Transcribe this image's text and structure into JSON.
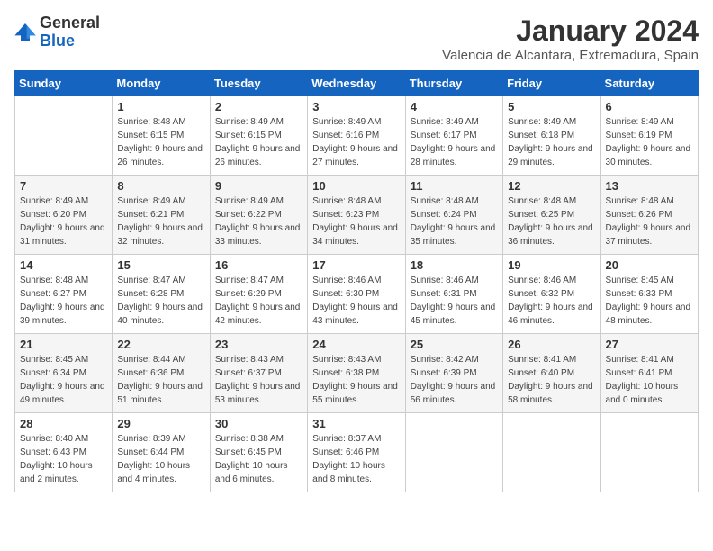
{
  "header": {
    "logo_general": "General",
    "logo_blue": "Blue",
    "month_title": "January 2024",
    "location": "Valencia de Alcantara, Extremadura, Spain"
  },
  "calendar": {
    "days_of_week": [
      "Sunday",
      "Monday",
      "Tuesday",
      "Wednesday",
      "Thursday",
      "Friday",
      "Saturday"
    ],
    "weeks": [
      [
        {
          "day": "",
          "sunrise": "",
          "sunset": "",
          "daylight": ""
        },
        {
          "day": "1",
          "sunrise": "Sunrise: 8:48 AM",
          "sunset": "Sunset: 6:15 PM",
          "daylight": "Daylight: 9 hours and 26 minutes."
        },
        {
          "day": "2",
          "sunrise": "Sunrise: 8:49 AM",
          "sunset": "Sunset: 6:15 PM",
          "daylight": "Daylight: 9 hours and 26 minutes."
        },
        {
          "day": "3",
          "sunrise": "Sunrise: 8:49 AM",
          "sunset": "Sunset: 6:16 PM",
          "daylight": "Daylight: 9 hours and 27 minutes."
        },
        {
          "day": "4",
          "sunrise": "Sunrise: 8:49 AM",
          "sunset": "Sunset: 6:17 PM",
          "daylight": "Daylight: 9 hours and 28 minutes."
        },
        {
          "day": "5",
          "sunrise": "Sunrise: 8:49 AM",
          "sunset": "Sunset: 6:18 PM",
          "daylight": "Daylight: 9 hours and 29 minutes."
        },
        {
          "day": "6",
          "sunrise": "Sunrise: 8:49 AM",
          "sunset": "Sunset: 6:19 PM",
          "daylight": "Daylight: 9 hours and 30 minutes."
        }
      ],
      [
        {
          "day": "7",
          "sunrise": "Sunrise: 8:49 AM",
          "sunset": "Sunset: 6:20 PM",
          "daylight": "Daylight: 9 hours and 31 minutes."
        },
        {
          "day": "8",
          "sunrise": "Sunrise: 8:49 AM",
          "sunset": "Sunset: 6:21 PM",
          "daylight": "Daylight: 9 hours and 32 minutes."
        },
        {
          "day": "9",
          "sunrise": "Sunrise: 8:49 AM",
          "sunset": "Sunset: 6:22 PM",
          "daylight": "Daylight: 9 hours and 33 minutes."
        },
        {
          "day": "10",
          "sunrise": "Sunrise: 8:48 AM",
          "sunset": "Sunset: 6:23 PM",
          "daylight": "Daylight: 9 hours and 34 minutes."
        },
        {
          "day": "11",
          "sunrise": "Sunrise: 8:48 AM",
          "sunset": "Sunset: 6:24 PM",
          "daylight": "Daylight: 9 hours and 35 minutes."
        },
        {
          "day": "12",
          "sunrise": "Sunrise: 8:48 AM",
          "sunset": "Sunset: 6:25 PM",
          "daylight": "Daylight: 9 hours and 36 minutes."
        },
        {
          "day": "13",
          "sunrise": "Sunrise: 8:48 AM",
          "sunset": "Sunset: 6:26 PM",
          "daylight": "Daylight: 9 hours and 37 minutes."
        }
      ],
      [
        {
          "day": "14",
          "sunrise": "Sunrise: 8:48 AM",
          "sunset": "Sunset: 6:27 PM",
          "daylight": "Daylight: 9 hours and 39 minutes."
        },
        {
          "day": "15",
          "sunrise": "Sunrise: 8:47 AM",
          "sunset": "Sunset: 6:28 PM",
          "daylight": "Daylight: 9 hours and 40 minutes."
        },
        {
          "day": "16",
          "sunrise": "Sunrise: 8:47 AM",
          "sunset": "Sunset: 6:29 PM",
          "daylight": "Daylight: 9 hours and 42 minutes."
        },
        {
          "day": "17",
          "sunrise": "Sunrise: 8:46 AM",
          "sunset": "Sunset: 6:30 PM",
          "daylight": "Daylight: 9 hours and 43 minutes."
        },
        {
          "day": "18",
          "sunrise": "Sunrise: 8:46 AM",
          "sunset": "Sunset: 6:31 PM",
          "daylight": "Daylight: 9 hours and 45 minutes."
        },
        {
          "day": "19",
          "sunrise": "Sunrise: 8:46 AM",
          "sunset": "Sunset: 6:32 PM",
          "daylight": "Daylight: 9 hours and 46 minutes."
        },
        {
          "day": "20",
          "sunrise": "Sunrise: 8:45 AM",
          "sunset": "Sunset: 6:33 PM",
          "daylight": "Daylight: 9 hours and 48 minutes."
        }
      ],
      [
        {
          "day": "21",
          "sunrise": "Sunrise: 8:45 AM",
          "sunset": "Sunset: 6:34 PM",
          "daylight": "Daylight: 9 hours and 49 minutes."
        },
        {
          "day": "22",
          "sunrise": "Sunrise: 8:44 AM",
          "sunset": "Sunset: 6:36 PM",
          "daylight": "Daylight: 9 hours and 51 minutes."
        },
        {
          "day": "23",
          "sunrise": "Sunrise: 8:43 AM",
          "sunset": "Sunset: 6:37 PM",
          "daylight": "Daylight: 9 hours and 53 minutes."
        },
        {
          "day": "24",
          "sunrise": "Sunrise: 8:43 AM",
          "sunset": "Sunset: 6:38 PM",
          "daylight": "Daylight: 9 hours and 55 minutes."
        },
        {
          "day": "25",
          "sunrise": "Sunrise: 8:42 AM",
          "sunset": "Sunset: 6:39 PM",
          "daylight": "Daylight: 9 hours and 56 minutes."
        },
        {
          "day": "26",
          "sunrise": "Sunrise: 8:41 AM",
          "sunset": "Sunset: 6:40 PM",
          "daylight": "Daylight: 9 hours and 58 minutes."
        },
        {
          "day": "27",
          "sunrise": "Sunrise: 8:41 AM",
          "sunset": "Sunset: 6:41 PM",
          "daylight": "Daylight: 10 hours and 0 minutes."
        }
      ],
      [
        {
          "day": "28",
          "sunrise": "Sunrise: 8:40 AM",
          "sunset": "Sunset: 6:43 PM",
          "daylight": "Daylight: 10 hours and 2 minutes."
        },
        {
          "day": "29",
          "sunrise": "Sunrise: 8:39 AM",
          "sunset": "Sunset: 6:44 PM",
          "daylight": "Daylight: 10 hours and 4 minutes."
        },
        {
          "day": "30",
          "sunrise": "Sunrise: 8:38 AM",
          "sunset": "Sunset: 6:45 PM",
          "daylight": "Daylight: 10 hours and 6 minutes."
        },
        {
          "day": "31",
          "sunrise": "Sunrise: 8:37 AM",
          "sunset": "Sunset: 6:46 PM",
          "daylight": "Daylight: 10 hours and 8 minutes."
        },
        {
          "day": "",
          "sunrise": "",
          "sunset": "",
          "daylight": ""
        },
        {
          "day": "",
          "sunrise": "",
          "sunset": "",
          "daylight": ""
        },
        {
          "day": "",
          "sunrise": "",
          "sunset": "",
          "daylight": ""
        }
      ]
    ]
  }
}
